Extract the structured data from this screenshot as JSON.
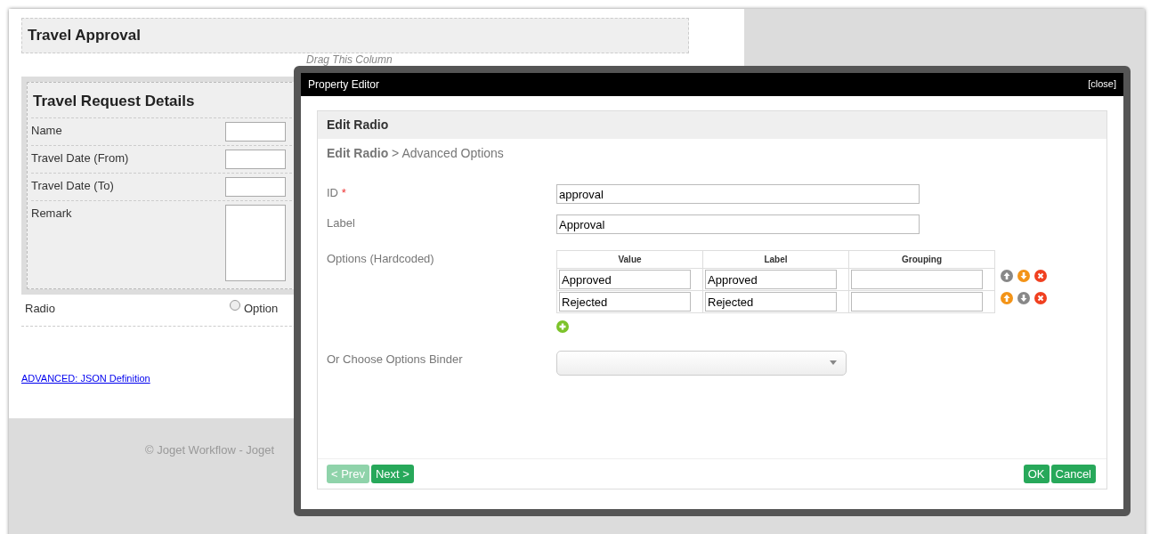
{
  "form": {
    "title": "Travel Approval",
    "drag_hint": "Drag This Column",
    "section_title": "Travel Request Details",
    "fields": [
      {
        "label": "Name",
        "kind": "text"
      },
      {
        "label": "Travel Date (From)",
        "kind": "text"
      },
      {
        "label": "Travel Date (To)",
        "kind": "text"
      },
      {
        "label": "Remark",
        "kind": "textarea"
      }
    ],
    "radio": {
      "label": "Radio",
      "option": "Option",
      "checked": false
    },
    "advanced_link": "ADVANCED: JSON Definition",
    "footer": "© Joget Workflow - Joget"
  },
  "dialog": {
    "title": "Property Editor",
    "close": "[close]",
    "panel_title": "Edit Radio",
    "breadcrumb": "**Edit Radio** > Advanced Options",
    "id_label": "ID",
    "required_mark": "*",
    "id_value": "approval",
    "label_label": "Label",
    "label_value": "Approval",
    "options_label": "Options (Hardcoded)",
    "columns": [
      "Value",
      "Label",
      "Grouping"
    ],
    "options": [
      {
        "value": "Approved",
        "label": "Approved",
        "can_move_up": false,
        "can_move_down": true
      },
      {
        "value": "Rejected",
        "label": "Rejected",
        "can_move_up": true,
        "can_move_down": false
      }
    ],
    "binder_label": "Or Choose Options Binder",
    "buttons": [
      {
        "label": "< Prev",
        "disabled": true
      },
      {
        "label": "Next >",
        "disabled": false
      },
      {
        "label": "OK",
        "disabled": false
      },
      {
        "label": "Cancel",
        "disabled": false
      }
    ]
  }
}
